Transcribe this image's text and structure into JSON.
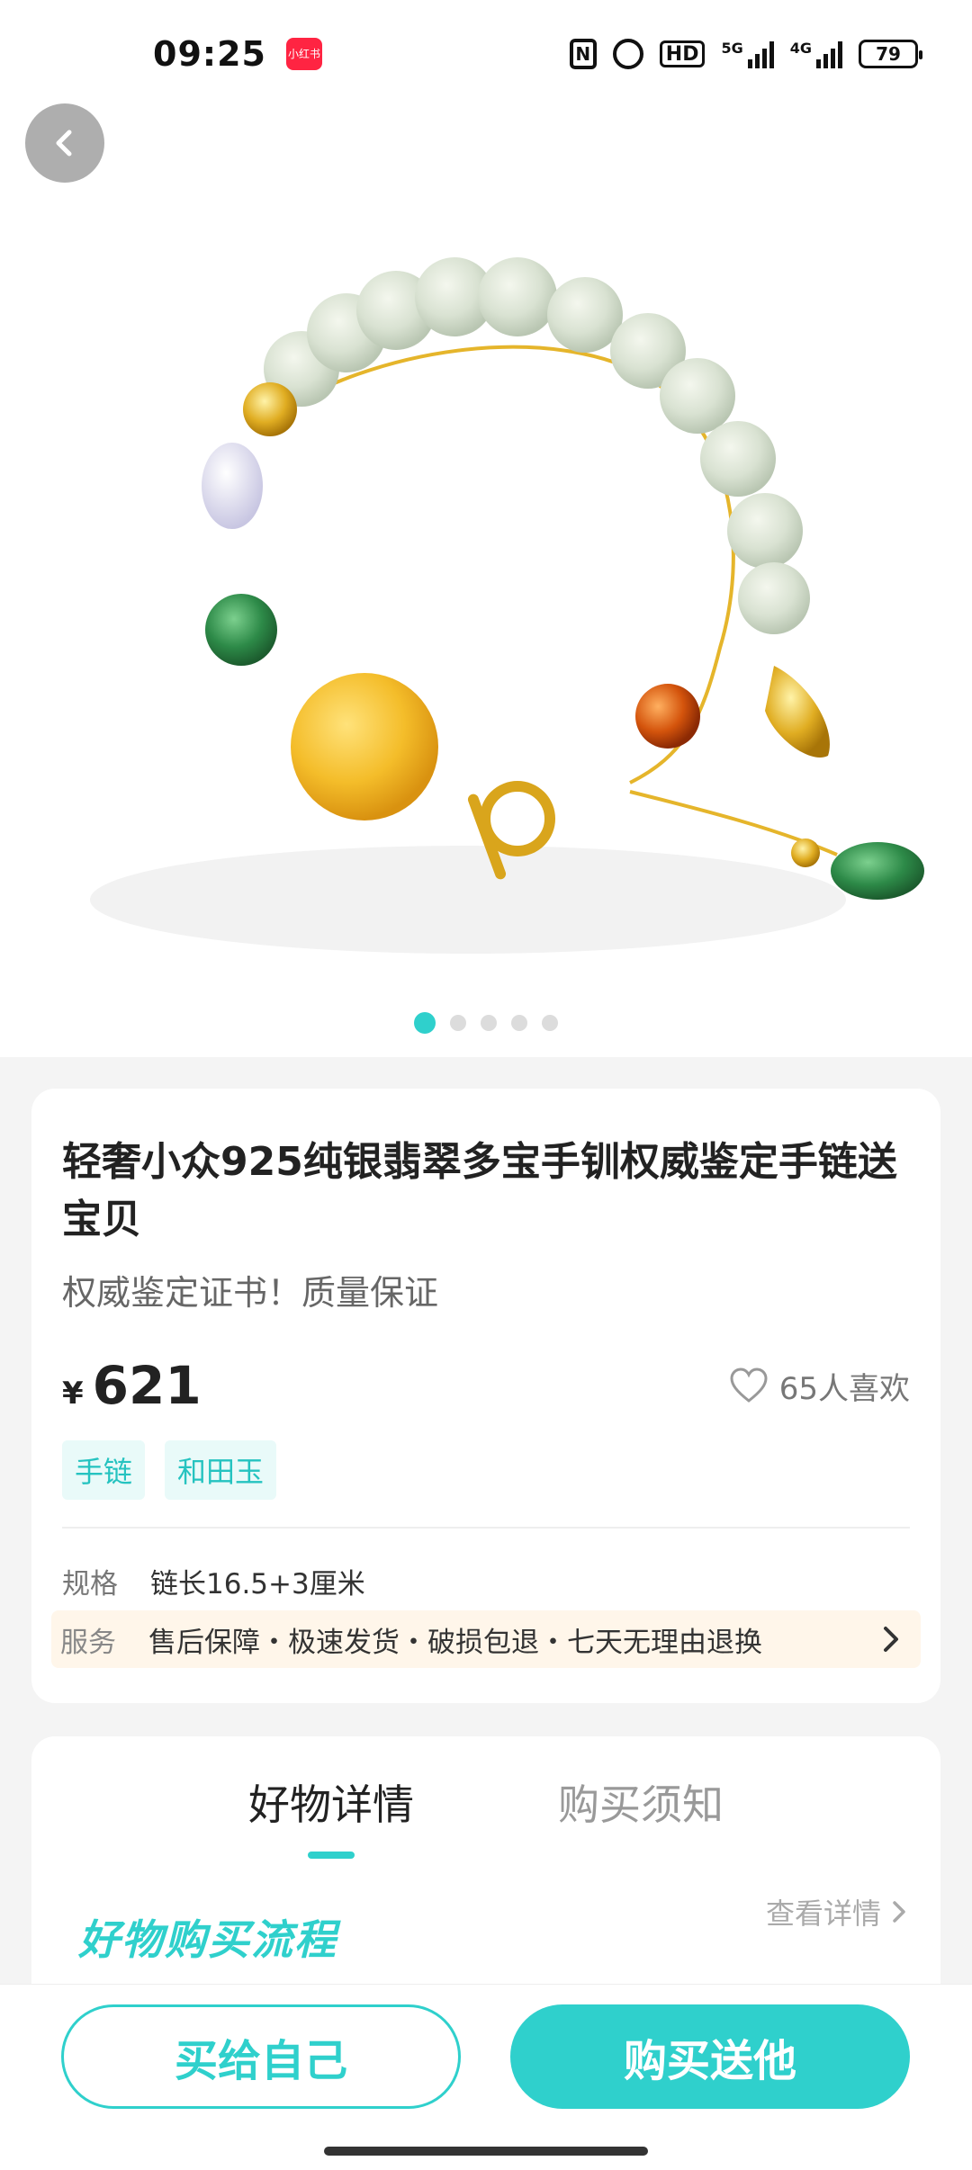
{
  "status_bar": {
    "time": "09:25",
    "app_badge": "小红书",
    "hd_label": "HD",
    "signal_5g": "5G",
    "signal_4g": "4G",
    "battery": "79",
    "icons": [
      "nfc-icon",
      "alarm-icon",
      "hd-icon",
      "signal-5g-icon",
      "signal-4g-icon",
      "battery-icon"
    ]
  },
  "hero": {
    "image_count": 5,
    "active_index": 0,
    "back_icon": "chevron-left-icon"
  },
  "product": {
    "title": "轻奢小众925纯银翡翠多宝手钏权威鉴定手链送宝贝",
    "subtitle": "权威鉴定证书！质量保证",
    "currency": "¥",
    "price": "621",
    "likes": "65人喜欢",
    "tags": [
      "手链",
      "和田玉"
    ],
    "spec_label": "规格",
    "spec_value": "链长16.5+3厘米",
    "service_label": "服务",
    "service_value": "售后保障・极速发货・破损包退・七天无理由退换"
  },
  "detail": {
    "tabs": [
      {
        "label": "好物详情",
        "active": true
      },
      {
        "label": "购买须知",
        "active": false
      }
    ],
    "flow_title": "好物购买流程",
    "view_more": "查看详情"
  },
  "actions": {
    "buy_self": "买给自己",
    "buy_gift": "购买送他"
  },
  "colors": {
    "accent": "#2fd0cc",
    "tag_bg": "#e9faf9",
    "service_bg": "#fff6ea"
  }
}
